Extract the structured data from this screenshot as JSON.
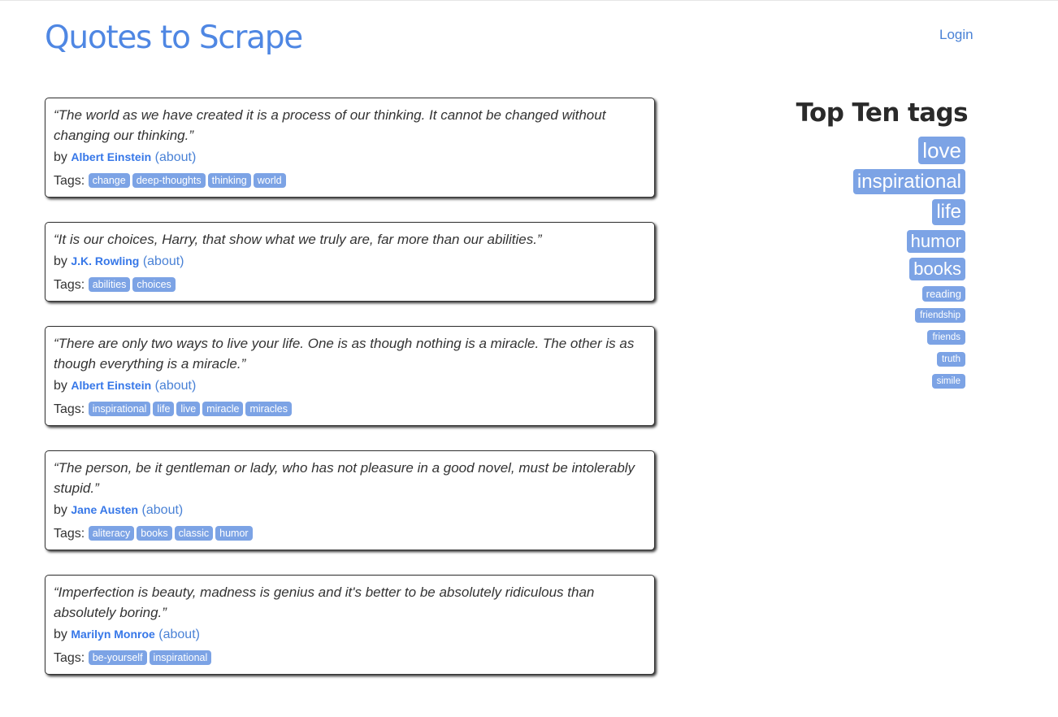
{
  "header": {
    "title": "Quotes to Scrape",
    "login": "Login"
  },
  "quotes": [
    {
      "text": "“The world as we have created it is a process of our thinking. It cannot be changed without changing our thinking.”",
      "by": "by",
      "author": "Albert Einstein",
      "about": "(about)",
      "tags_label": "Tags:",
      "tags": [
        "change",
        "deep-thoughts",
        "thinking",
        "world"
      ]
    },
    {
      "text": "“It is our choices, Harry, that show what we truly are, far more than our abilities.”",
      "by": "by",
      "author": "J.K. Rowling",
      "about": "(about)",
      "tags_label": "Tags:",
      "tags": [
        "abilities",
        "choices"
      ]
    },
    {
      "text": "“There are only two ways to live your life. One is as though nothing is a miracle. The other is as though everything is a miracle.”",
      "by": "by",
      "author": "Albert Einstein",
      "about": "(about)",
      "tags_label": "Tags:",
      "tags": [
        "inspirational",
        "life",
        "live",
        "miracle",
        "miracles"
      ]
    },
    {
      "text": "“The person, be it gentleman or lady, who has not pleasure in a good novel, must be intolerably stupid.”",
      "by": "by",
      "author": "Jane Austen",
      "about": "(about)",
      "tags_label": "Tags:",
      "tags": [
        "aliteracy",
        "books",
        "classic",
        "humor"
      ]
    },
    {
      "text": "“Imperfection is beauty, madness is genius and it's better to be absolutely ridiculous than absolutely boring.”",
      "by": "by",
      "author": "Marilyn Monroe",
      "about": "(about)",
      "tags_label": "Tags:",
      "tags": [
        "be-yourself",
        "inspirational"
      ]
    }
  ],
  "top_tags": {
    "heading": "Top Ten tags",
    "items": [
      "love",
      "inspirational",
      "life",
      "humor",
      "books",
      "reading",
      "friendship",
      "friends",
      "truth",
      "simile"
    ]
  },
  "colors": {
    "accent": "#4f87e3",
    "link": "#4a82d6",
    "tag_bg": "#7ca3e5",
    "text": "#333333"
  }
}
